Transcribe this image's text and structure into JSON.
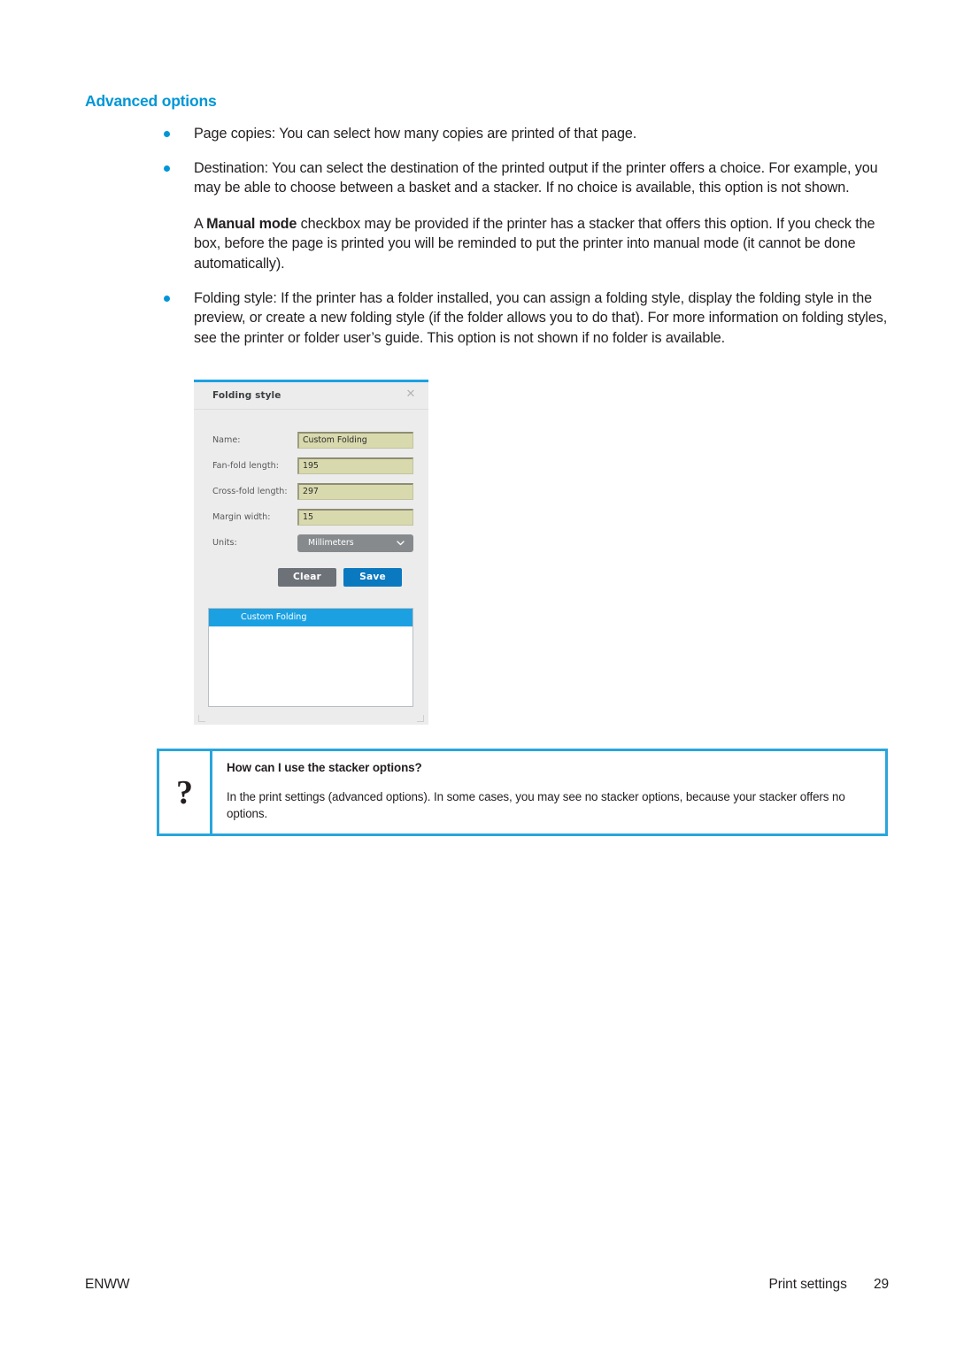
{
  "heading": "Advanced options",
  "bullets": [
    {
      "paragraphs": [
        {
          "text": "Page copies: You can select how many copies are printed of that page."
        }
      ]
    },
    {
      "paragraphs": [
        {
          "text": "Destination: You can select the destination of the printed output if the printer offers a choice. For example, you may be able to choose between a basket and a stacker. If no choice is available, this option is not shown."
        },
        {
          "before": "A ",
          "bold": "Manual mode",
          "after": " checkbox may be provided if the printer has a stacker that offers this option. If you check the box, before the page is printed you will be reminded to put the printer into manual mode (it cannot be done automatically)."
        }
      ]
    },
    {
      "paragraphs": [
        {
          "text": "Folding style: If the printer has a folder installed, you can assign a folding style, display the folding style in the preview, or create a new folding style (if the folder allows you to do that). For more information on folding styles, see the printer or folder user’s guide. This option is not shown if no folder is available."
        }
      ]
    }
  ],
  "dialog": {
    "title": "Folding style",
    "close_icon": "close-icon",
    "fields": [
      {
        "label": "Name:",
        "value": "Custom Folding",
        "type": "text"
      },
      {
        "label": "Fan-fold length:",
        "value": "195",
        "type": "text"
      },
      {
        "label": "Cross-fold length:",
        "value": "297",
        "type": "text"
      },
      {
        "label": "Margin width:",
        "value": "15",
        "type": "text"
      }
    ],
    "units": {
      "label": "Units:",
      "value": "Millimeters",
      "chevron_icon": "chevron-down-icon"
    },
    "buttons": {
      "clear": "Clear",
      "save": "Save"
    },
    "list": {
      "selected_item": "Custom Folding"
    },
    "colors": {
      "accent_top": "#1ba1e2",
      "field_fill": "#d9d9ae",
      "select_fill": "#878a8d",
      "clear_button": "#6d7278",
      "save_button": "#0b79c0",
      "selection": "#1ba1e2"
    }
  },
  "callout": {
    "icon": "question-mark-icon",
    "title": "How can I use the stacker options?",
    "text": "In the print settings (advanced options). In some cases, you may see no stacker options, because your stacker offers no options.",
    "border_color": "#29a5dc"
  },
  "footer": {
    "left": "ENWW",
    "section": "Print settings",
    "page_number": "29"
  },
  "colors": {
    "heading": "#0096d6",
    "bullet": "#0096d6",
    "body_text": "#231f20"
  }
}
